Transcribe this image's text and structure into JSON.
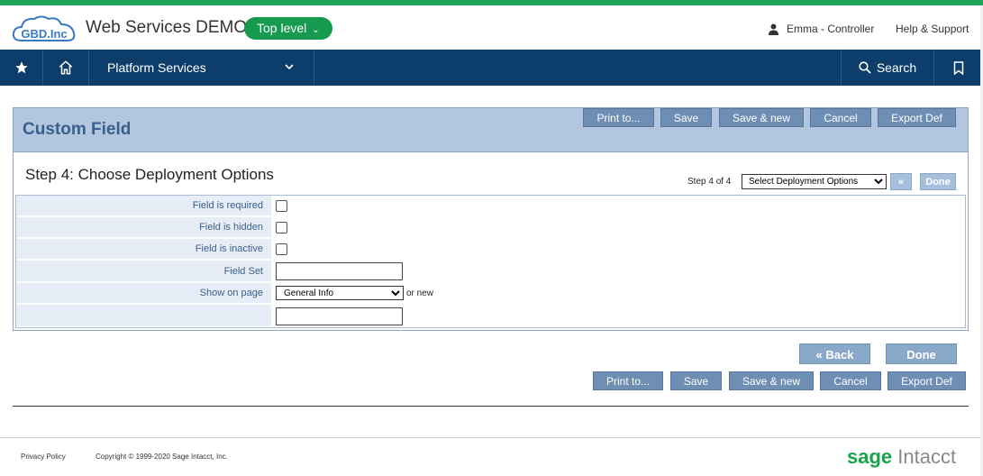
{
  "header": {
    "logo_text": "GBD.Inc",
    "app_title": "Web Services DEMO",
    "level_label": "Top level",
    "user_label": "Emma - Controller",
    "help_label": "Help & Support"
  },
  "nav": {
    "platform_label": "Platform Services",
    "search_label": "Search"
  },
  "panel": {
    "title": "Custom Field",
    "top_buttons": {
      "print": "Print to...",
      "save": "Save",
      "save_new": "Save & new",
      "cancel": "Cancel",
      "export": "Export Def"
    },
    "step_title": "Step 4: Choose Deployment Options",
    "step_count": "Step 4 of 4",
    "step_select_value": "Select Deployment Options",
    "prev_label": "«",
    "done_small_label": "Done",
    "fields": {
      "required_label": "Field is required",
      "hidden_label": "Field is hidden",
      "inactive_label": "Field is inactive",
      "field_set_label": "Field Set",
      "show_on_page_label": "Show on page",
      "show_on_page_value": "General Info",
      "or_new": "or new"
    }
  },
  "bottom": {
    "back_label": "« Back",
    "done_label": "Done",
    "print": "Print to...",
    "save": "Save",
    "save_new": "Save & new",
    "cancel": "Cancel",
    "export": "Export Def"
  },
  "footer": {
    "privacy": "Privacy Policy",
    "copyright": "Copyright © 1999-2020 Sage Intacct, Inc.",
    "brand_sage": "sage",
    "brand_intacct": " Intacct"
  },
  "colors": {
    "accent_green": "#169a4f",
    "nav_blue": "#0d3e6b",
    "panel_blue": "#b3c6df"
  }
}
